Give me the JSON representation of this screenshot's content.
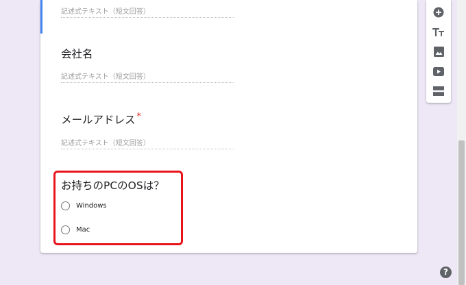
{
  "form": {
    "questions": [
      {
        "placeholder": "記述式テキスト（短文回答）"
      },
      {
        "title": "会社名",
        "placeholder": "記述式テキスト（短文回答）"
      },
      {
        "title": "メールアドレス",
        "required_mark": "*",
        "placeholder": "記述式テキスト（短文回答）"
      },
      {
        "title": "お持ちのPCのOSは？",
        "options": [
          "Windows",
          "Mac"
        ]
      }
    ]
  },
  "toolbar": {
    "items": [
      "add-question-icon",
      "add-title-icon",
      "add-image-icon",
      "add-video-icon",
      "add-section-icon"
    ]
  },
  "help": {
    "label": "?"
  },
  "colors": {
    "background": "#ede7f6",
    "focus_bar": "#4285f4",
    "required": "#d93025",
    "highlight": "#e8141b"
  }
}
